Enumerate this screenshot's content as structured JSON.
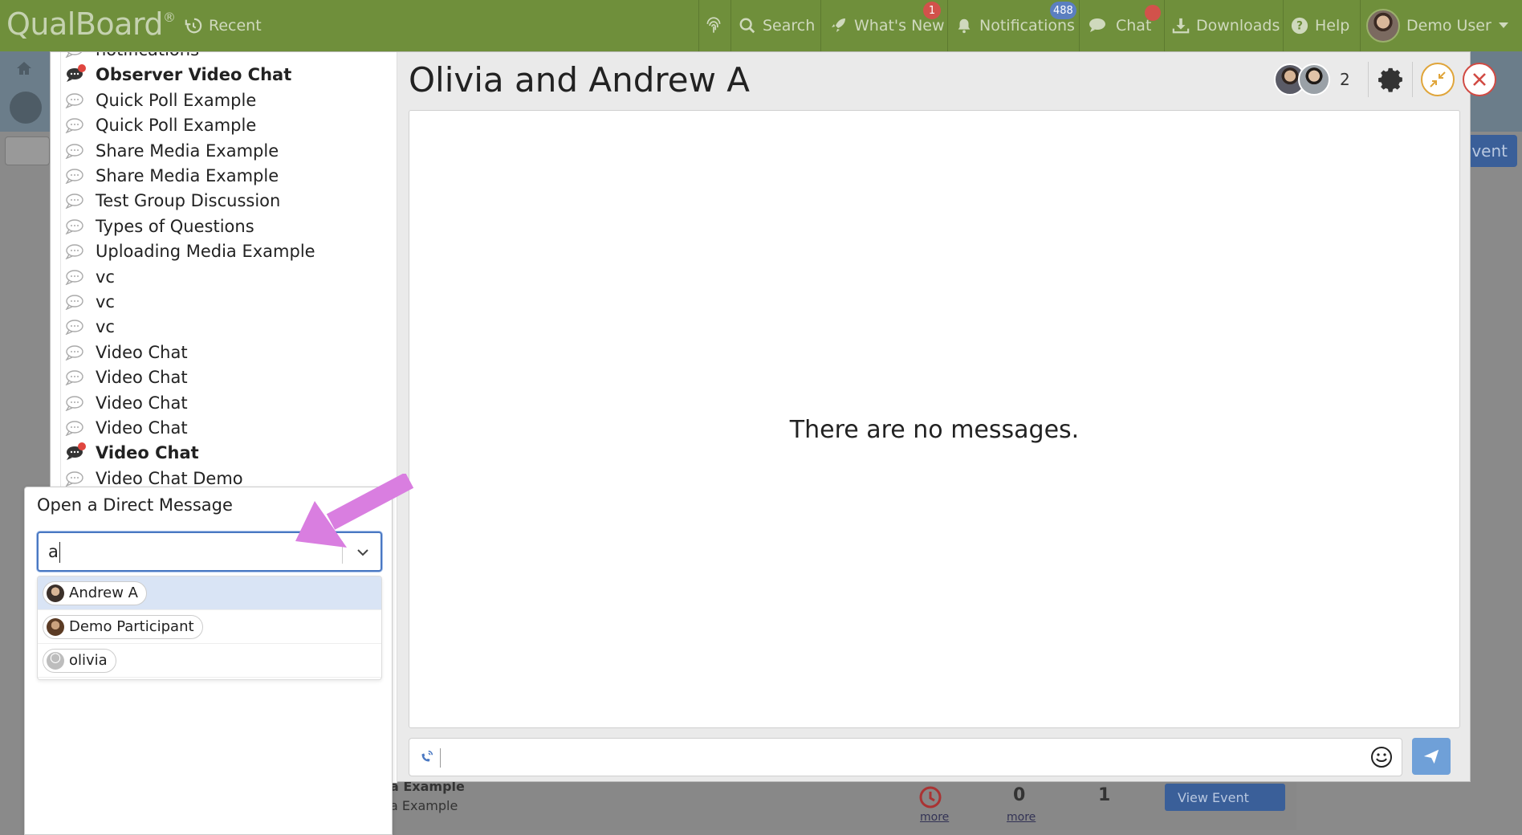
{
  "topbar": {
    "logo": "QualBoard",
    "logo_mark": "®",
    "recent": "Recent",
    "search": "Search",
    "whats_new": "What's New",
    "whats_new_badge": "1",
    "notifications": "Notifications",
    "notifications_badge": "488",
    "chat": "Chat",
    "downloads": "Downloads",
    "help": "Help",
    "user": "Demo User"
  },
  "background": {
    "button_fragment": "vent",
    "example_line1": "a Example",
    "example_line2": "a Example",
    "stat1_value": "0",
    "stat1_link": "more",
    "stat2_value": "1",
    "clock_link": "more",
    "view_event": "View Event"
  },
  "conversations": [
    {
      "label": "notifications",
      "bold": false,
      "unread": false
    },
    {
      "label": "Observer Video Chat",
      "bold": true,
      "unread": true
    },
    {
      "label": "Quick Poll Example",
      "bold": false,
      "unread": false
    },
    {
      "label": "Quick Poll Example",
      "bold": false,
      "unread": false
    },
    {
      "label": "Share Media Example",
      "bold": false,
      "unread": false
    },
    {
      "label": "Share Media Example",
      "bold": false,
      "unread": false
    },
    {
      "label": "Test Group Discussion",
      "bold": false,
      "unread": false
    },
    {
      "label": "Types of Questions",
      "bold": false,
      "unread": false
    },
    {
      "label": "Uploading Media Example",
      "bold": false,
      "unread": false
    },
    {
      "label": "vc",
      "bold": false,
      "unread": false
    },
    {
      "label": "vc",
      "bold": false,
      "unread": false
    },
    {
      "label": "vc",
      "bold": false,
      "unread": false
    },
    {
      "label": "Video Chat",
      "bold": false,
      "unread": false
    },
    {
      "label": "Video Chat",
      "bold": false,
      "unread": false
    },
    {
      "label": "Video Chat",
      "bold": false,
      "unread": false
    },
    {
      "label": "Video Chat",
      "bold": false,
      "unread": false
    },
    {
      "label": "Video Chat",
      "bold": true,
      "unread": true
    },
    {
      "label": "Video Chat Demo",
      "bold": false,
      "unread": false
    }
  ],
  "conversation": {
    "title": "Olivia and Andrew A",
    "participant_count": "2",
    "empty_text": "There are no messages."
  },
  "direct_message": {
    "title": "Open a Direct Message",
    "input_value": "a",
    "options": [
      {
        "name": "Andrew A",
        "active": true
      },
      {
        "name": "Demo Participant",
        "active": false
      },
      {
        "name": "olivia",
        "active": false
      }
    ]
  },
  "colors": {
    "topbar": "#6f8f3b",
    "accent": "#4a78c2",
    "send": "#6fa0d8",
    "unread_dot": "#e0463f",
    "annotation_arrow": "#d97ee0"
  }
}
